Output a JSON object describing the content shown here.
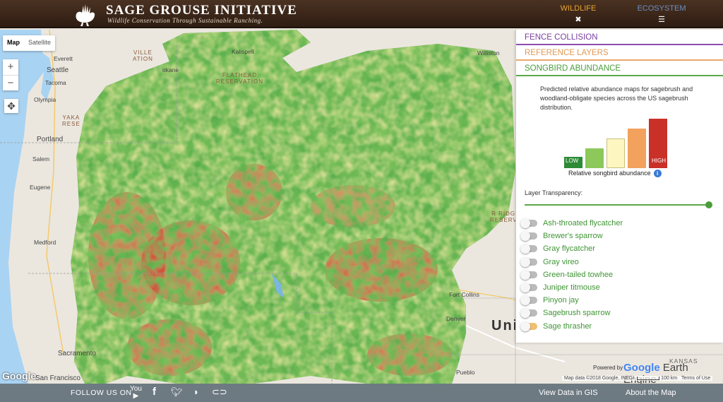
{
  "header": {
    "title": "SAGE GROUSE INITIATIVE",
    "tagline": "Wildlife Conservation Through Sustainable Ranching.",
    "nav": [
      {
        "label": "WILDLIFE",
        "icon": "close-icon",
        "glyph": "✖"
      },
      {
        "label": "ECOSYSTEM",
        "icon": "menu-icon",
        "glyph": "☰"
      }
    ]
  },
  "map": {
    "type_controls": {
      "map": "Map",
      "satellite": "Satellite"
    },
    "zoom_in": "+",
    "zoom_out": "−",
    "labels": {
      "everett": "Everett",
      "seattle": "Seattle",
      "tacoma": "Tacoma",
      "olympia": "Olympia",
      "portland": "Portland",
      "salem": "Salem",
      "eugene": "Eugene",
      "medford": "Medford",
      "sacramento": "Sacramento",
      "san_francisco": "San Francisco",
      "kalispell": "Kalispell",
      "williston": "Williston",
      "denver": "Denver",
      "fort_collins": "Fort Collins",
      "pueblo": "Pueblo",
      "kansas": "KANSAS",
      "united": "Uni",
      "colville_res": "VILLE\nATION",
      "flathead_res": "FLATHEAD\nRESERVATION",
      "yakama_res": "YAKA\nRESE",
      "wind_river_res": "R RIDGE\nRESERVA",
      "okane": "okane"
    },
    "google_logo": "Google",
    "powered_by": "Powered by",
    "earth_engine": {
      "google": "Google",
      "rest": " Earth Engine"
    },
    "map_data": "Map data ©2018 Google, INEGI",
    "scale": "100 km",
    "terms": "Terms of Use"
  },
  "panel": {
    "sections": [
      "FENCE COLLISION",
      "REFERENCE LAYERS",
      "SONGBIRD ABUNDANCE"
    ],
    "description": "Predicted relative abundance maps for sagebrush and woodland-obligate species across the US sagebrush distribution.",
    "legend": {
      "low": "LOW",
      "high": "HIGH",
      "caption": "Relative songbird abundance",
      "info_icon": "info-icon",
      "colors": [
        "#2d8a36",
        "#8cc85a",
        "#fdf6c0",
        "#f2a25c",
        "#c93028"
      ]
    },
    "transparency_label": "Layer Transparency:",
    "transparency_value": 1.0,
    "species": [
      {
        "name": "Ash-throated flycatcher",
        "on": false
      },
      {
        "name": "Brewer's sparrow",
        "on": false
      },
      {
        "name": "Gray flycatcher",
        "on": false
      },
      {
        "name": "Gray vireo",
        "on": false
      },
      {
        "name": "Green-tailed towhee",
        "on": false
      },
      {
        "name": "Juniper titmouse",
        "on": false
      },
      {
        "name": "Pinyon jay",
        "on": false
      },
      {
        "name": "Sagebrush sparrow",
        "on": false
      },
      {
        "name": "Sage thrasher",
        "on": true
      }
    ]
  },
  "footer": {
    "follow_us": "FOLLOW US ON",
    "social_icons": [
      "youtube-icon",
      "facebook-icon",
      "twitter-icon",
      "rss-icon",
      "link-icon"
    ],
    "links": [
      "View Data in GIS",
      "About the Map"
    ]
  }
}
